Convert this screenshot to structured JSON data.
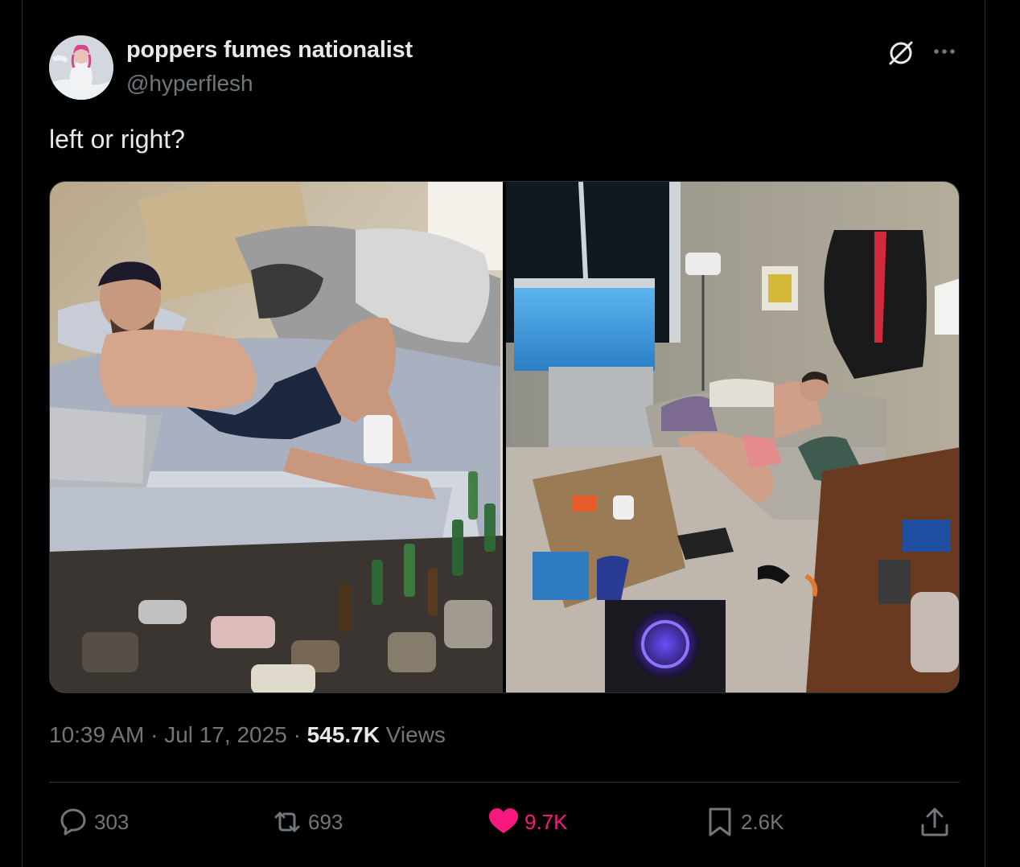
{
  "post": {
    "author": {
      "display_name": "poppers fumes nationalist",
      "handle": "@hyperflesh",
      "avatar_icon": "avatar"
    },
    "text": "left or right?",
    "media": {
      "type": "photo",
      "panels": 2
    },
    "meta": {
      "time": "10:39 AM",
      "separator": "·",
      "date": "Jul 17, 2025",
      "views_count": "545.7K",
      "views_label": "Views"
    },
    "actions": {
      "replies": "303",
      "reposts": "693",
      "likes": "9.7K",
      "bookmarks": "2.6K"
    }
  },
  "colors": {
    "background": "#000000",
    "text_primary": "#e7e9ea",
    "text_secondary": "#71767b",
    "like_active": "#f91880",
    "border": "#2f3336"
  },
  "icons": {
    "grok": "grok-icon",
    "more": "more-icon",
    "reply": "reply-icon",
    "retweet": "retweet-icon",
    "like": "heart-filled-icon",
    "bookmark": "bookmark-icon",
    "share": "share-icon"
  }
}
